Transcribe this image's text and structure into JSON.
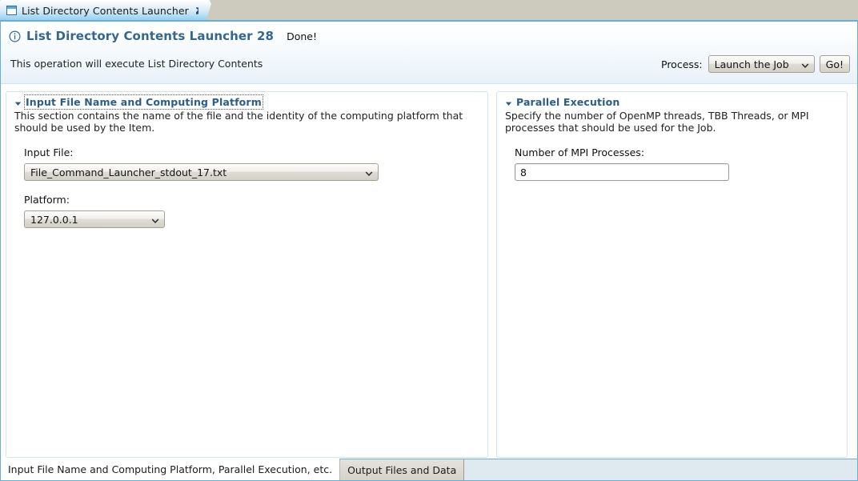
{
  "window": {
    "tab": {
      "label": "List Directory Contents Launcher",
      "icon": "form-window-icon",
      "close_icon": "close-icon"
    }
  },
  "header": {
    "info_icon": "info-circle-icon",
    "title": "List Directory Contents Launcher 28",
    "status": "Done!",
    "description": "This operation will execute List Directory Contents",
    "process": {
      "label": "Process:",
      "selected": "Launch the Job",
      "options": [
        "Launch the Job"
      ],
      "go_label": "Go!"
    }
  },
  "sections": {
    "left": {
      "title": "Input File Name and Computing Platform",
      "twisty_icon": "triangle-down-icon",
      "description": "This section contains the name of the file and the identity of the computing platform that should be used by the Item.",
      "fields": [
        {
          "label": "Input File:",
          "value": "File_Command_Launcher_stdout_17.txt",
          "options": [
            "File_Command_Launcher_stdout_17.txt"
          ]
        },
        {
          "label": "Platform:",
          "value": "127.0.0.1",
          "options": [
            "127.0.0.1"
          ]
        }
      ]
    },
    "right": {
      "title": "Parallel Execution",
      "twisty_icon": "triangle-down-icon",
      "description": "Specify the number of OpenMP threads, TBB Threads, or MPI processes that should be used for the Job.",
      "fields": [
        {
          "label": "Number of MPI Processes:",
          "value": "8"
        }
      ]
    }
  },
  "bottom_tabs": {
    "items": [
      {
        "label": "Input File Name and Computing Platform, Parallel Execution, etc.",
        "selected": true
      },
      {
        "label": "Output Files and Data",
        "selected": false
      }
    ]
  },
  "colors": {
    "accent_blue": "#6aaed6",
    "title_blue": "#35678e",
    "section_title_blue": "#2c5d86",
    "tab_bar_gray": "#cdcabe",
    "bottom_bar": "#dfe9f0"
  }
}
